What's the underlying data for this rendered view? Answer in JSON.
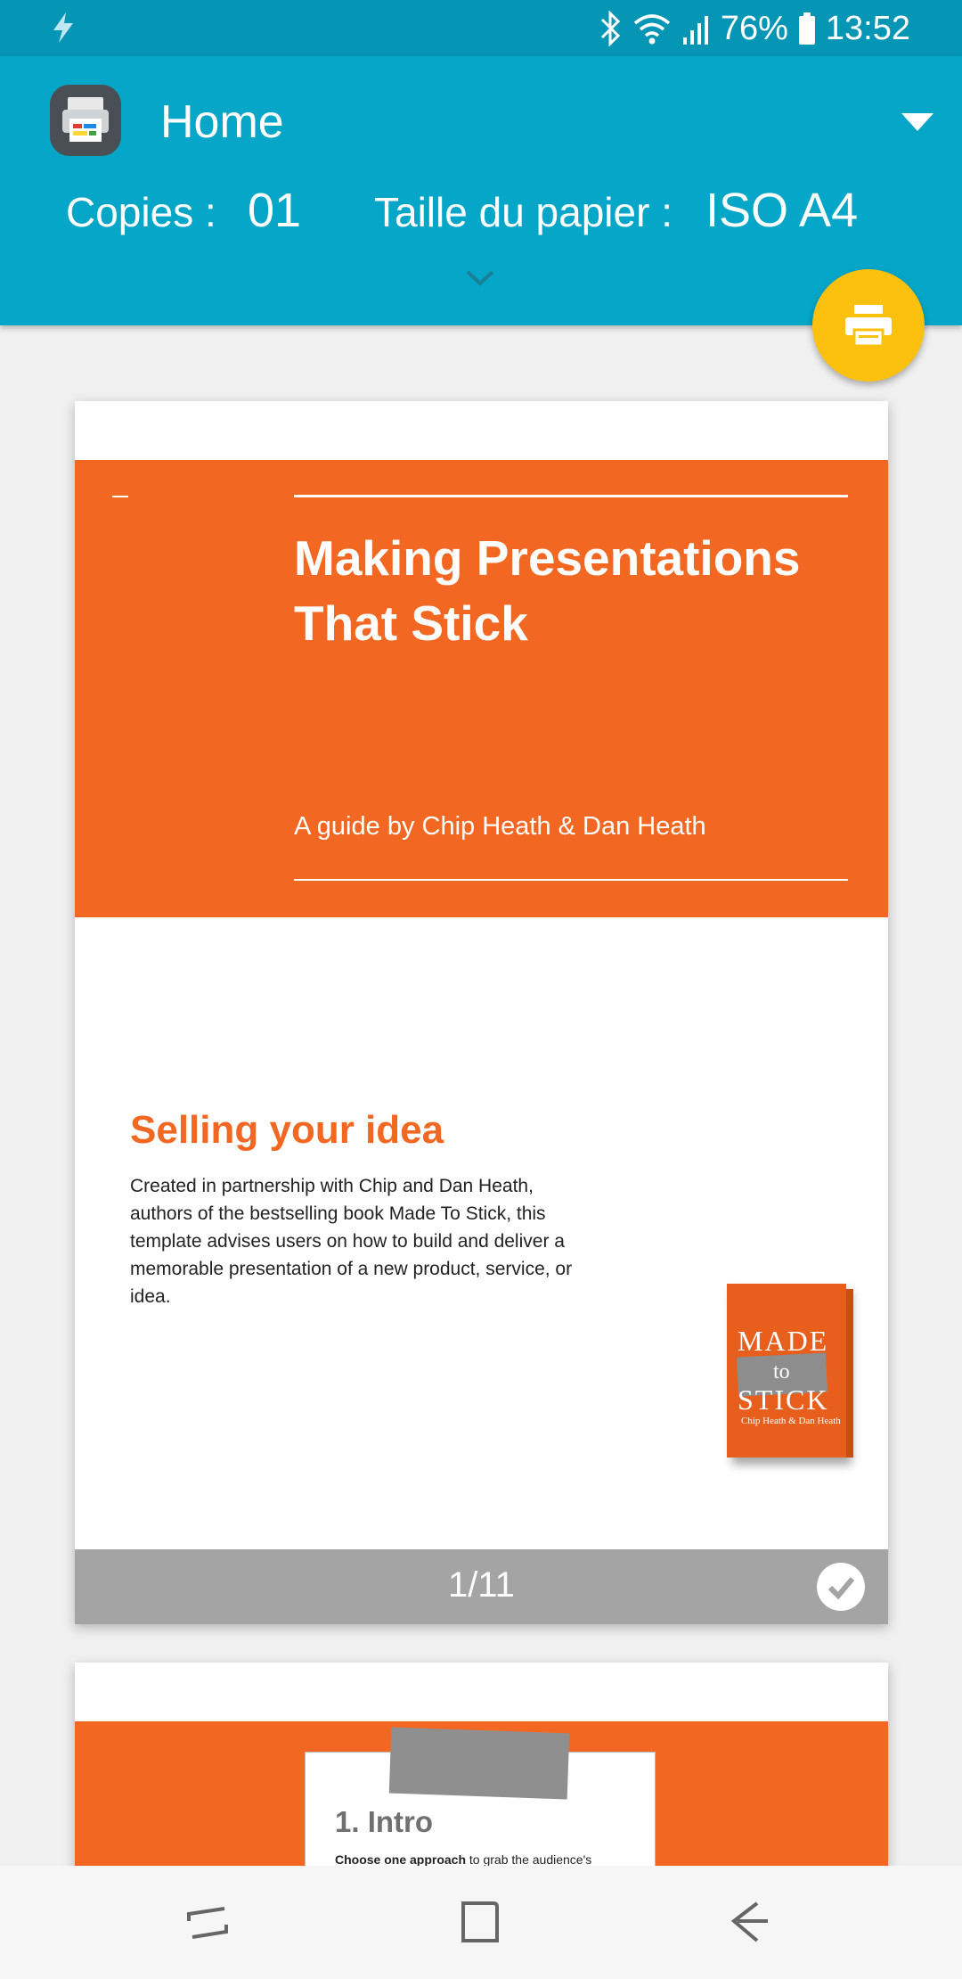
{
  "status_bar": {
    "battery": "76%",
    "time": "13:52",
    "icons": [
      "charging-bolt-icon",
      "bluetooth-icon",
      "wifi-icon",
      "signal-icon",
      "battery-icon"
    ]
  },
  "header": {
    "title": "Home",
    "copies_label": "Copies :",
    "copies_value": "01",
    "paper_label": "Taille du papier :",
    "paper_value": "ISO A4"
  },
  "colors": {
    "status_bar": "#0595b5",
    "app_bar": "#05a6c8",
    "fab": "#fcc10f",
    "slide_orange": "#f26823",
    "page_footer": "#a4a4a4"
  },
  "page1": {
    "title": "Making Presentations That Stick",
    "subtitle": "A guide by Chip Heath & Dan Heath",
    "section_heading": "Selling your idea",
    "section_body": "Created in partnership with Chip and Dan Heath, authors of the bestselling book Made To Stick, this template advises users on how to build and deliver a memorable presentation of a new product, service, or idea.",
    "book_made": "MADE",
    "book_to": "to",
    "book_stick": "STICK",
    "book_authors": "Chip Heath & Dan Heath",
    "page_number": "1/11"
  },
  "page2": {
    "heading": "1. Intro",
    "text_bold": "Choose one approach",
    "text_rest": " to grab the audience's"
  }
}
